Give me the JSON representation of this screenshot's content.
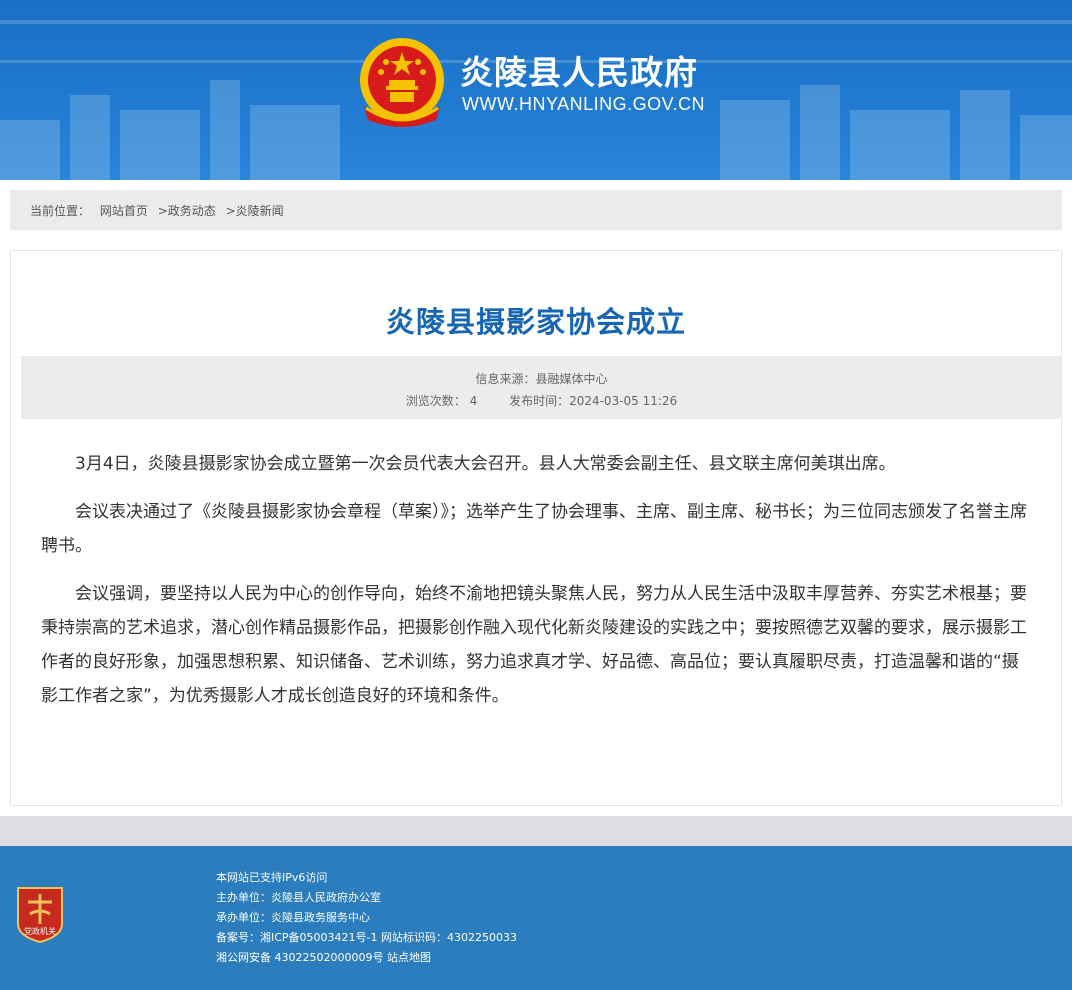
{
  "header": {
    "site_name": "炎陵县人民政府",
    "site_url": "WWW.HNYANLING.GOV.CN"
  },
  "breadcrumb": {
    "label": "当前位置：",
    "home": "网站首页",
    "level1": ">政务动态",
    "level2": ">炎陵新闻"
  },
  "article": {
    "title": "炎陵县摄影家协会成立",
    "source": "信息来源：县融媒体中心",
    "views": "浏览次数：  4",
    "published": "发布时间：2024-03-05 11:26",
    "paragraphs": [
      "3月4日，炎陵县摄影家协会成立暨第一次会员代表大会召开。县人大常委会副主任、县文联主席何美琪出席。",
      "会议表决通过了《炎陵县摄影家协会章程（草案）》；选举产生了协会理事、主席、副主席、秘书长；为三位同志颁发了名誉主席聘书。",
      "会议强调，要坚持以人民为中心的创作导向，始终不渝地把镜头聚焦人民，努力从人民生活中汲取丰厚营养、夯实艺术根基；要秉持崇高的艺术追求，潜心创作精品摄影作品，把摄影创作融入现代化新炎陵建设的实践之中；要按照德艺双馨的要求，展示摄影工作者的良好形象，加强思想积累、知识储备、艺术训练，努力追求真才学、好品德、高品位；要认真履职尽责，打造温馨和谐的“摄影工作者之家”，为优秀摄影人才成长创造良好的环境和条件。"
    ]
  },
  "footer": {
    "badge_text": "党政机关",
    "ipv6": "本网站已支持IPv6访问",
    "sponsor": "主办单位：炎陵县人民政府办公室",
    "operator": "承办单位：炎陵县政务服务中心",
    "icp": "备案号：湘ICP备05003421号-1 网站标识码：4302250033",
    "police": "湘公网安备 43022502000009号",
    "sitemap": "站点地图"
  },
  "colors": {
    "header_blue": "#1f7ad0",
    "title_blue": "#1766b5",
    "footer_blue": "#2b7dbd",
    "emblem_red": "#d71a1a",
    "emblem_gold": "#f5c200"
  }
}
